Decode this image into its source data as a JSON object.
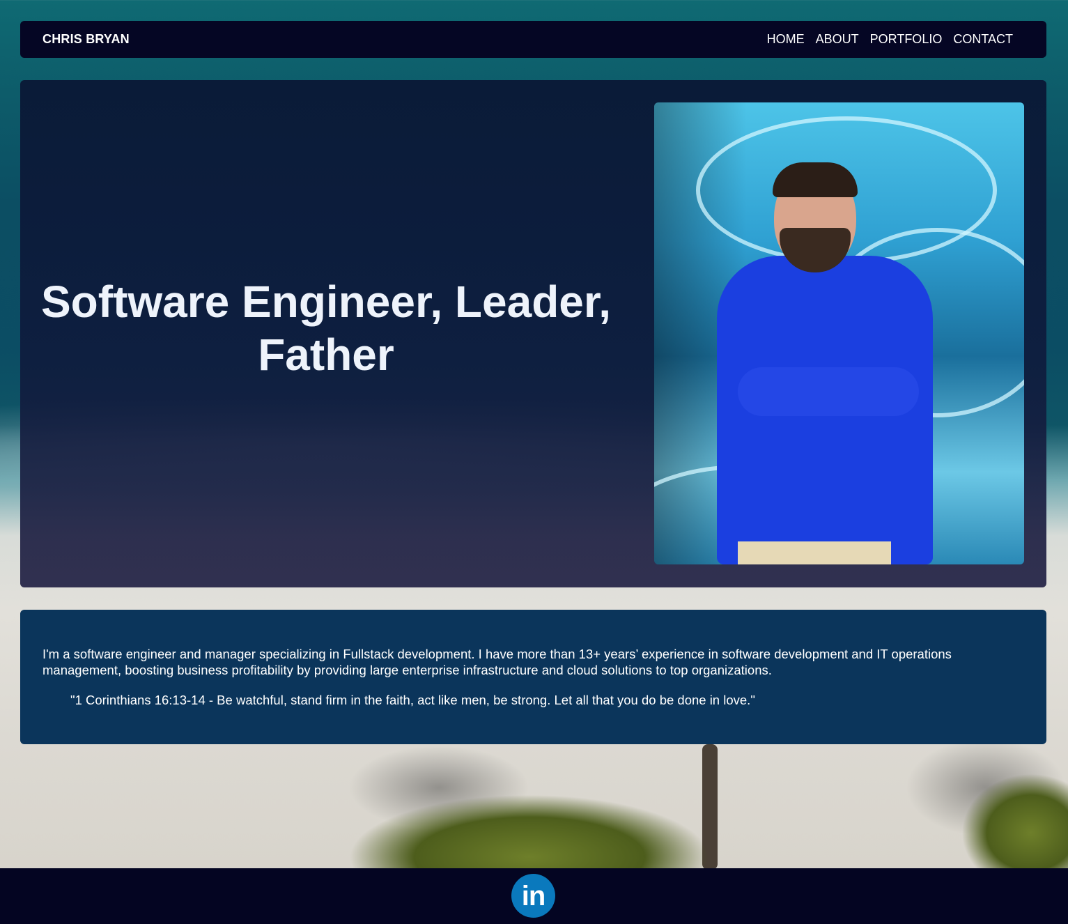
{
  "nav": {
    "brand": "CHRIS BRYAN",
    "links": [
      {
        "label": "HOME"
      },
      {
        "label": "ABOUT"
      },
      {
        "label": "PORTFOLIO"
      },
      {
        "label": "CONTACT"
      }
    ]
  },
  "hero": {
    "title": "Software Engineer, Leader, Father"
  },
  "about": {
    "text": "I'm a software engineer and manager specializing in Fullstack development. I have more than 13+ years’ experience in software development and IT operations management, boosting business profitability by providing large enterprise infrastructure and cloud solutions to top organizations.",
    "quote": "\"1 Corinthians 16:13-14 - Be watchful, stand firm in the faith, act like men, be strong. Let all that you do be done in love.\""
  },
  "footer": {
    "social_icon": "linkedin-icon",
    "social_glyph": "in"
  },
  "colors": {
    "nav_bg": "#050624",
    "about_bg": "#0b355b",
    "footer_bg": "#040522",
    "linkedin_blue": "#0a79bd"
  }
}
